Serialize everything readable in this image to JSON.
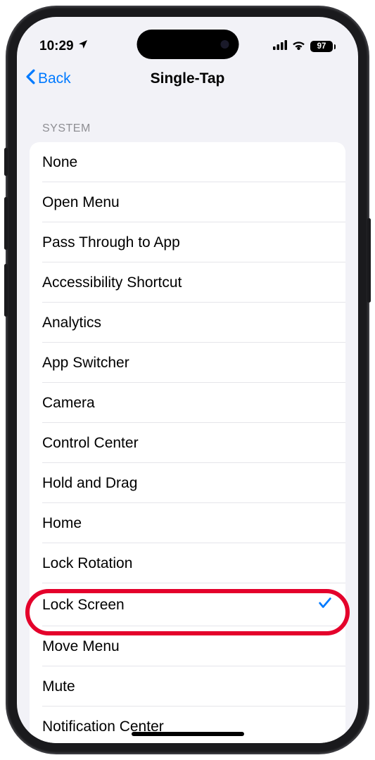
{
  "status": {
    "time": "10:29",
    "battery": "97"
  },
  "nav": {
    "back_label": "Back",
    "title": "Single-Tap"
  },
  "section": {
    "header": "SYSTEM"
  },
  "items": [
    {
      "label": "None",
      "selected": false
    },
    {
      "label": "Open Menu",
      "selected": false
    },
    {
      "label": "Pass Through to App",
      "selected": false
    },
    {
      "label": "Accessibility Shortcut",
      "selected": false
    },
    {
      "label": "Analytics",
      "selected": false
    },
    {
      "label": "App Switcher",
      "selected": false
    },
    {
      "label": "Camera",
      "selected": false
    },
    {
      "label": "Control Center",
      "selected": false
    },
    {
      "label": "Hold and Drag",
      "selected": false
    },
    {
      "label": "Home",
      "selected": false
    },
    {
      "label": "Lock Rotation",
      "selected": false
    },
    {
      "label": "Lock Screen",
      "selected": true,
      "highlighted": true
    },
    {
      "label": "Move Menu",
      "selected": false
    },
    {
      "label": "Mute",
      "selected": false
    },
    {
      "label": "Notification Center",
      "selected": false
    }
  ]
}
